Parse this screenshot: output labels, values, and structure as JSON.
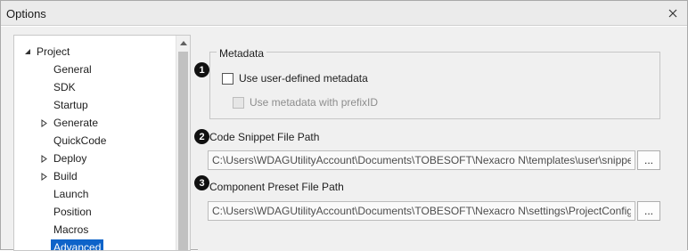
{
  "window": {
    "title": "Options"
  },
  "tree": {
    "root": {
      "label": "Project",
      "expanded": true
    },
    "items": [
      {
        "label": "General",
        "expandable": false
      },
      {
        "label": "SDK",
        "expandable": false
      },
      {
        "label": "Startup",
        "expandable": false
      },
      {
        "label": "Generate",
        "expandable": true
      },
      {
        "label": "QuickCode",
        "expandable": false
      },
      {
        "label": "Deploy",
        "expandable": true
      },
      {
        "label": "Build",
        "expandable": true
      },
      {
        "label": "Launch",
        "expandable": false
      },
      {
        "label": "Position",
        "expandable": false
      },
      {
        "label": "Macros",
        "expandable": false
      },
      {
        "label": "Advanced",
        "expandable": false,
        "selected": true
      }
    ]
  },
  "metadata": {
    "group_label": "Metadata",
    "use_user_defined_label": "Use user-defined metadata",
    "use_user_defined_checked": false,
    "use_prefix_label": "Use metadata with prefixID",
    "use_prefix_checked": false,
    "use_prefix_disabled": true
  },
  "markers": {
    "one": "1",
    "two": "2",
    "three": "3"
  },
  "code_snippet": {
    "label": "Code Snippet File Path",
    "value": "C:\\Users\\WDAGUtilityAccount\\Documents\\TOBESOFT\\Nexacro N\\templates\\user\\snippe",
    "browse_label": "..."
  },
  "component_preset": {
    "label": "Component Preset File Path",
    "value": "C:\\Users\\WDAGUtilityAccount\\Documents\\TOBESOFT\\Nexacro N\\settings\\ProjectConfig",
    "browse_label": "..."
  },
  "colors": {
    "selection": "#0e63c9",
    "panel_bg": "#f0f0f0",
    "marker": "#111111"
  },
  "icons": {
    "close": "close-icon",
    "expanded": "triangle-down-icon",
    "collapsed": "triangle-right-icon",
    "scroll_up": "arrow-up-icon"
  }
}
